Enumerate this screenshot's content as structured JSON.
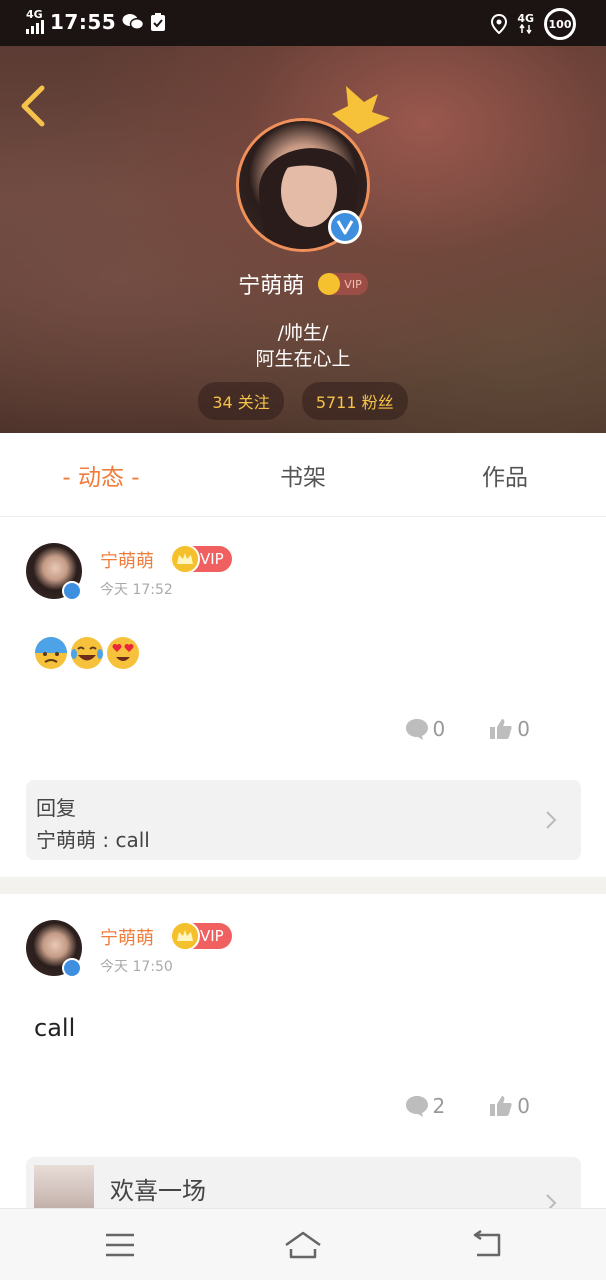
{
  "status_bar": {
    "network_left": "4G",
    "time": "17:55",
    "network_right": "4G",
    "battery": "100",
    "icons": [
      "signal-icon",
      "wechat-icon",
      "clipboard-check-icon",
      "location-icon",
      "data-arrows-icon",
      "battery-icon"
    ]
  },
  "profile": {
    "back_icon": "chevron-left-icon",
    "name": "宁萌萌",
    "vip_label": "VIP",
    "bio_line1": "/帅生/",
    "bio_line2": "阿生在心上",
    "following": "34 关注",
    "followers": "5711 粉丝",
    "accent_color": "#f5c24a"
  },
  "tabs": [
    {
      "label": "- 动态 -",
      "active": true
    },
    {
      "label": "书架",
      "active": false
    },
    {
      "label": "作品",
      "active": false
    }
  ],
  "posts": [
    {
      "author": "宁萌萌",
      "vip": "VIP",
      "time": "今天 17:52",
      "emojis": [
        "cold-sweat-emoji",
        "tears-of-joy-emoji",
        "heart-eyes-emoji"
      ],
      "comments": "0",
      "likes": "0",
      "reply_title": "回复",
      "reply_text": "宁萌萌 : call"
    },
    {
      "author": "宁萌萌",
      "vip": "VIP",
      "time": "今天 17:50",
      "text": "call",
      "comments": "2",
      "likes": "0",
      "work_title": "欢喜一场"
    }
  ],
  "nav": {
    "icons": [
      "menu-icon",
      "home-icon",
      "back-icon"
    ]
  },
  "colors": {
    "orange": "#f07c3c",
    "vip_red": "#f06060",
    "verify_blue": "#3f8fe0"
  }
}
